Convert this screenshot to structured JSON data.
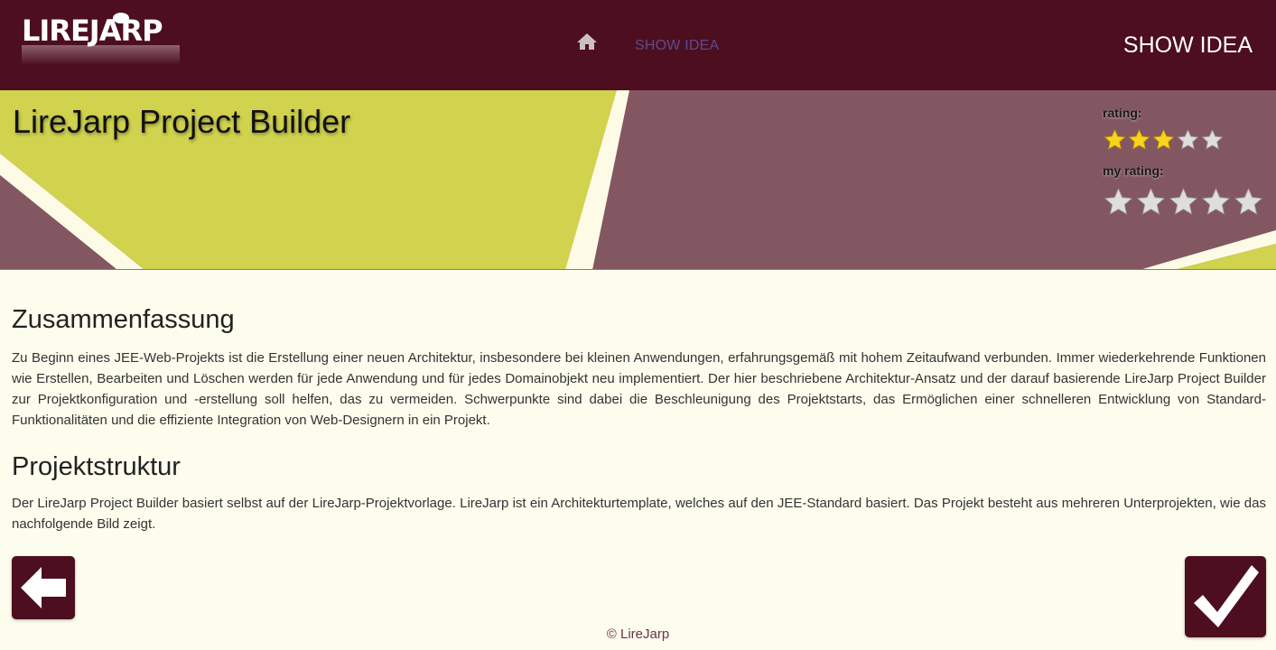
{
  "header": {
    "logo_text": "LIREJARP",
    "nav": {
      "home_icon": "home-icon",
      "link_label": "SHOW IDEA"
    },
    "page_heading": "SHOW IDEA"
  },
  "banner": {
    "title": "LireJarp Project Builder",
    "rating_label": "rating:",
    "rating_value": 3,
    "rating_max": 5,
    "my_rating_label": "my rating:",
    "my_rating_value": 0,
    "colors": {
      "olive": "#d1d24e",
      "mauve": "#835761",
      "stripe": "#fdfbe6"
    }
  },
  "content": {
    "sections": [
      {
        "heading": "Zusammenfassung",
        "text": "Zu Beginn eines JEE-Web-Projekts ist die Erstellung einer neuen Architektur, insbesondere bei kleinen Anwendungen, erfahrungsgemäß mit hohem Zeitaufwand verbunden. Immer wiederkehrende Funktionen wie Erstellen, Bearbeiten und Löschen werden für jede Anwendung und für jedes Domainobjekt neu implementiert. Der hier beschriebene Architektur-Ansatz und der darauf basierende LireJarp Project Builder zur Projektkonfiguration und -erstellung soll helfen, das zu vermeiden. Schwerpunkte sind dabei die Beschleunigung des Projektstarts, das Ermöglichen einer schnelleren Entwicklung von Standard-Funktionalitäten und die effiziente Integration von Web-Designern in ein Projekt."
      },
      {
        "heading": "Projektstruktur",
        "text": "Der LireJarp Project Builder basiert selbst auf der LireJarp-Projektvorlage. LireJarp ist ein Architekturtemplate, welches auf den JEE-Standard basiert. Das Projekt besteht aus mehreren Unterprojekten, wie das nachfolgende Bild zeigt."
      }
    ]
  },
  "actions": {
    "back_icon": "arrow-left-icon",
    "confirm_icon": "checkmark-icon"
  },
  "footer": {
    "text": "© LireJarp"
  },
  "theme": {
    "primary": "#4d0e1f",
    "background": "#fdfdee",
    "nav_link": "#5a4d8e"
  }
}
